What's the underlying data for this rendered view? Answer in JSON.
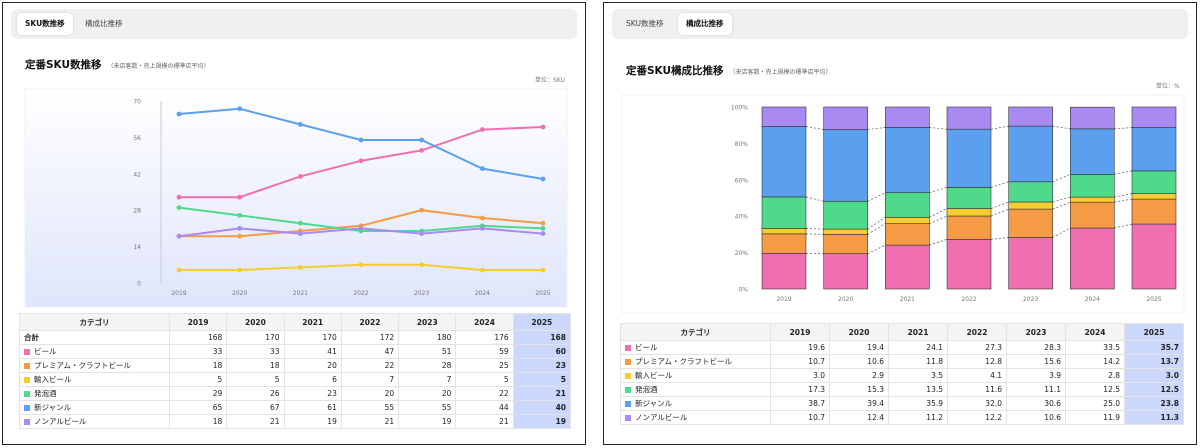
{
  "left_panel": {
    "tabs": [
      {
        "label": "SKU数推移",
        "active": true
      },
      {
        "label": "構成比推移",
        "active": false
      }
    ],
    "title": "定番SKU数推移",
    "subtitle": "（来店客数・売上規模の標準店平均）",
    "unit": "単位：SKU",
    "table": {
      "header": [
        "カテゴリ",
        "2019",
        "2020",
        "2021",
        "2022",
        "2023",
        "2024",
        "2025"
      ],
      "total": {
        "label": "合計",
        "values": [
          "168",
          "170",
          "170",
          "172",
          "180",
          "176",
          "168"
        ]
      },
      "rows": [
        {
          "label": "ビール",
          "values": [
            "33",
            "33",
            "41",
            "47",
            "51",
            "59",
            "60"
          ]
        },
        {
          "label": "プレミアム・クラフトビール",
          "values": [
            "18",
            "18",
            "20",
            "22",
            "28",
            "25",
            "23"
          ]
        },
        {
          "label": "輸入ビール",
          "values": [
            "5",
            "5",
            "6",
            "7",
            "7",
            "5",
            "5"
          ]
        },
        {
          "label": "発泡酒",
          "values": [
            "29",
            "26",
            "23",
            "20",
            "20",
            "22",
            "21"
          ]
        },
        {
          "label": "新ジャンル",
          "values": [
            "65",
            "67",
            "61",
            "55",
            "55",
            "44",
            "40"
          ]
        },
        {
          "label": "ノンアルビール",
          "values": [
            "18",
            "21",
            "19",
            "21",
            "19",
            "21",
            "19"
          ]
        }
      ]
    }
  },
  "right_panel": {
    "tabs": [
      {
        "label": "SKU数推移",
        "active": false
      },
      {
        "label": "構成比推移",
        "active": true
      }
    ],
    "title": "定番SKU構成比推移",
    "subtitle": "（来店客数・売上規模の標準店平均）",
    "unit": "単位：%",
    "table": {
      "header": [
        "カテゴリ",
        "2019",
        "2020",
        "2021",
        "2022",
        "2023",
        "2024",
        "2025"
      ],
      "rows": [
        {
          "label": "ビール",
          "values": [
            "19.6",
            "19.4",
            "24.1",
            "27.3",
            "28.3",
            "33.5",
            "35.7"
          ]
        },
        {
          "label": "プレミアム・クラフトビール",
          "values": [
            "10.7",
            "10.6",
            "11.8",
            "12.8",
            "15.6",
            "14.2",
            "13.7"
          ]
        },
        {
          "label": "輸入ビール",
          "values": [
            "3.0",
            "2.9",
            "3.5",
            "4.1",
            "3.9",
            "2.8",
            "3.0"
          ]
        },
        {
          "label": "発泡酒",
          "values": [
            "17.3",
            "15.3",
            "13.5",
            "11.6",
            "11.1",
            "12.5",
            "12.5"
          ]
        },
        {
          "label": "新ジャンル",
          "values": [
            "38.7",
            "39.4",
            "35.9",
            "32.0",
            "30.6",
            "25.0",
            "23.8"
          ]
        },
        {
          "label": "ノンアルビール",
          "values": [
            "10.7",
            "12.4",
            "11.2",
            "12.2",
            "10.6",
            "11.9",
            "11.3"
          ]
        }
      ]
    }
  },
  "colors": {
    "ビール": "#ef6fb0",
    "プレミアム・クラフトビール": "#f59a45",
    "輸入ビール": "#f5cd2e",
    "発泡酒": "#4fd98a",
    "新ジャンル": "#5aa0ee",
    "ノンアルビール": "#a98af0",
    "highlight": "#ccd8fb"
  },
  "chart_data": [
    {
      "type": "line",
      "x": [
        "2019",
        "2020",
        "2021",
        "2022",
        "2023",
        "2024",
        "2025"
      ],
      "yticks": [
        "0",
        "14",
        "28",
        "42",
        "56",
        "70"
      ],
      "ylim": [
        0,
        70
      ],
      "grid": false,
      "series": [
        {
          "name": "ビール",
          "values": [
            33,
            33,
            41,
            47,
            51,
            59,
            60
          ]
        },
        {
          "name": "プレミアム・クラフトビール",
          "values": [
            18,
            18,
            20,
            22,
            28,
            25,
            23
          ]
        },
        {
          "name": "輸入ビール",
          "values": [
            5,
            5,
            6,
            7,
            7,
            5,
            5
          ]
        },
        {
          "name": "発泡酒",
          "values": [
            29,
            26,
            23,
            20,
            20,
            22,
            21
          ]
        },
        {
          "name": "新ジャンル",
          "values": [
            65,
            67,
            61,
            55,
            55,
            44,
            40
          ]
        },
        {
          "name": "ノンアルビール",
          "values": [
            18,
            21,
            19,
            21,
            19,
            21,
            19
          ]
        }
      ]
    },
    {
      "type": "bar",
      "stacked": true,
      "categories": [
        "2019",
        "2020",
        "2021",
        "2022",
        "2023",
        "2024",
        "2025"
      ],
      "yticks": [
        "0%",
        "20%",
        "40%",
        "60%",
        "80%",
        "100%"
      ],
      "ylim": [
        0,
        100
      ],
      "grid": false,
      "series": [
        {
          "name": "ビール",
          "values": [
            19.6,
            19.4,
            24.1,
            27.3,
            28.3,
            33.5,
            35.7
          ]
        },
        {
          "name": "プレミアム・クラフトビール",
          "values": [
            10.7,
            10.6,
            11.8,
            12.8,
            15.6,
            14.2,
            13.7
          ]
        },
        {
          "name": "輸入ビール",
          "values": [
            3.0,
            2.9,
            3.5,
            4.1,
            3.9,
            2.8,
            3.0
          ]
        },
        {
          "name": "発泡酒",
          "values": [
            17.3,
            15.3,
            13.5,
            11.6,
            11.1,
            12.5,
            12.5
          ]
        },
        {
          "name": "新ジャンル",
          "values": [
            38.7,
            39.4,
            35.9,
            32.0,
            30.6,
            25.0,
            23.8
          ]
        },
        {
          "name": "ノンアルビール",
          "values": [
            10.7,
            12.4,
            11.2,
            12.2,
            10.6,
            11.9,
            11.3
          ]
        }
      ]
    }
  ]
}
